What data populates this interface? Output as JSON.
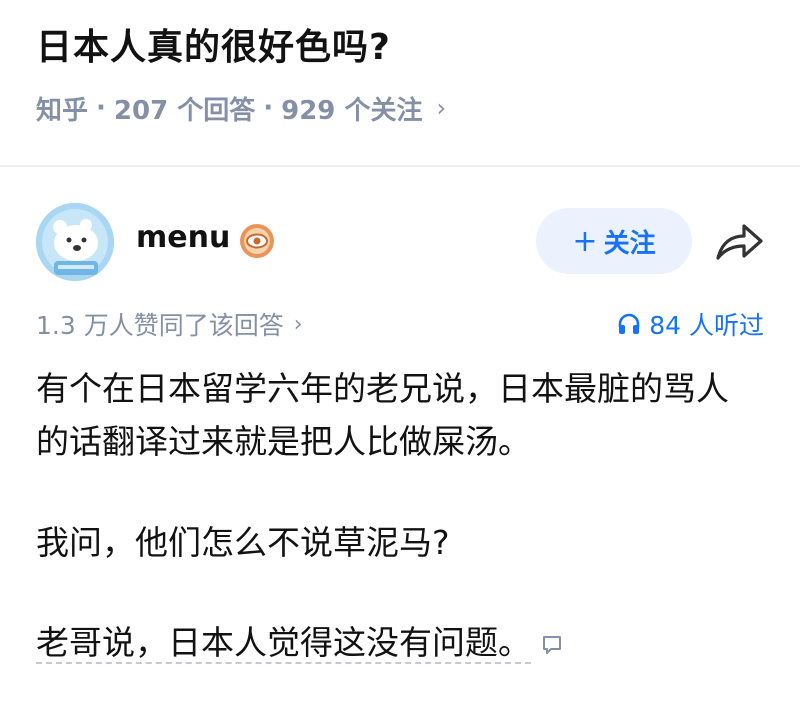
{
  "question": {
    "title": "日本人真的很好色吗?",
    "source": "知乎",
    "separator": "·",
    "answers_count": "207 个回答",
    "followers_count": "929 个关注",
    "chevron": "›"
  },
  "author": {
    "name": "menu",
    "avatar_icon": "polar-bear-avatar",
    "badge_icon": "eye-badge-icon",
    "follow_plus": "+",
    "follow_label": "关注",
    "share_icon": "share-arrow-icon"
  },
  "stats": {
    "approvals": "1.3 万人赞同了该回答",
    "chevron": "›",
    "listen_icon": "headphones-icon",
    "listens": "84 人听过"
  },
  "answer": {
    "paragraph1": "有个在日本留学六年的老兄说，日本最脏的骂人的话翻译过来就是把人比做屎汤。",
    "paragraph2": "我问，他们怎么不说草泥马?",
    "paragraph3": "老哥说，日本人觉得这没有问题。",
    "comment_icon": "comment-bubble-icon"
  },
  "colors": {
    "accent": "#1772f6",
    "follow_bg": "#ebf1fd",
    "meta_gray": "#8590a6",
    "text": "#121212",
    "badge_orange": "#e8955a"
  }
}
